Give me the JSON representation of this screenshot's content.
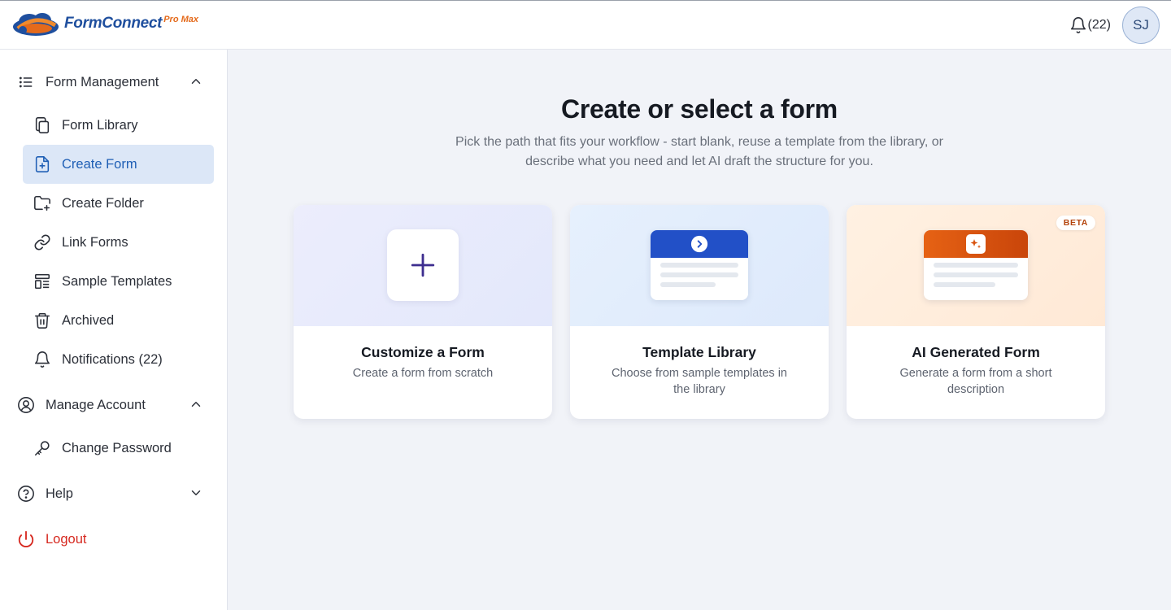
{
  "app": {
    "logo_main": "FormConnect",
    "logo_sub": "Pro Max"
  },
  "header": {
    "notification_count": "(22)",
    "avatar_initials": "SJ"
  },
  "sidebar": {
    "sections": [
      {
        "label": "Form Management",
        "expanded": true,
        "icon": "list-icon"
      },
      {
        "label": "Manage Account",
        "expanded": true,
        "icon": "user-circle-icon"
      },
      {
        "label": "Help",
        "expanded": false,
        "icon": "help-circle-icon"
      }
    ],
    "form_items": [
      {
        "label": "Form Library",
        "icon": "copy-icon",
        "active": false
      },
      {
        "label": "Create Form",
        "icon": "file-plus-icon",
        "active": true
      },
      {
        "label": "Create Folder",
        "icon": "folder-plus-icon",
        "active": false
      },
      {
        "label": "Link Forms",
        "icon": "link-icon",
        "active": false
      },
      {
        "label": "Sample Templates",
        "icon": "template-icon",
        "active": false
      },
      {
        "label": "Archived",
        "icon": "trash-icon",
        "active": false
      },
      {
        "label": "Notifications (22)",
        "icon": "bell-icon",
        "active": false
      }
    ],
    "account_items": [
      {
        "label": "Change Password",
        "icon": "key-icon"
      }
    ],
    "logout_label": "Logout"
  },
  "main": {
    "title": "Create or select a form",
    "subtitle": "Pick the path that fits your workflow - start blank, reuse a template from the library, or describe what you need and let AI draft the structure for you.",
    "cards": [
      {
        "title": "Customize a Form",
        "description": "Create a form from scratch"
      },
      {
        "title": "Template Library",
        "description": "Choose from sample templates in the library"
      },
      {
        "title": "AI Generated Form",
        "description": "Generate a form from a short description",
        "badge": "BETA"
      }
    ]
  },
  "colors": {
    "accent": "#1f5fb5",
    "active_bg": "#dce7f7",
    "logout": "#d6281f",
    "template_bar": "#2250c7",
    "ai_bar": "#e0560f"
  }
}
